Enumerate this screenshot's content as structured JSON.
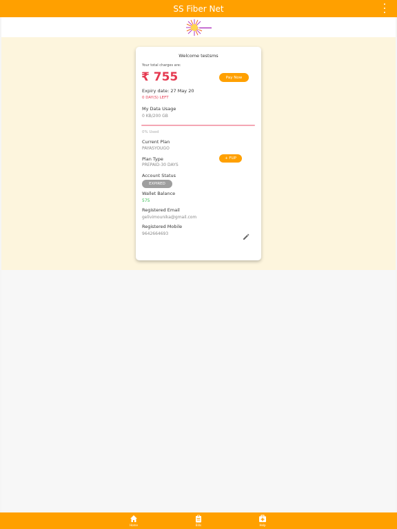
{
  "app": {
    "title": "SS Fiber Net",
    "menu_icon": "more-vert-icon",
    "logo_icon": "ss-fiber-net-logo"
  },
  "card": {
    "welcome": "Welcome testsms",
    "total_label": "Your total charges are:",
    "amount": "₹ 755",
    "pay_now": "Pay Now",
    "expiry": "Expiry date: 27 May 20",
    "days_left": "0 DAY(S) LEFT",
    "data_usage_label": "My Data Usage",
    "data_usage_value": "0 KB/200 GB",
    "usage_fraction": 0,
    "used_text": "0% Used",
    "plan_label": "Current Plan",
    "plan_value": "PAYASYOUGO",
    "fup_button": "+ FUP",
    "plan_type_label": "Plan Type",
    "plan_type_value": "PREPAID-30 DAYS",
    "status_label": "Account Status",
    "status_value": "EXPIRED",
    "wallet_label": "Wallet Balance",
    "wallet_value": "575",
    "email_label": "Registered Email",
    "email_value": "gelivimounika@gmail.com",
    "mobile_label": "Registered Mobile",
    "mobile_value": "9642664693",
    "edit_icon": "edit-icon"
  },
  "bottom_nav": [
    {
      "label": "Home",
      "icon": "home-icon"
    },
    {
      "label": "Bills",
      "icon": "bills-icon"
    },
    {
      "label": "Help",
      "icon": "help-icon"
    }
  ],
  "colors": {
    "accent": "#ffa000",
    "amount": "#e53950",
    "hero_bg": "#fdf5dd",
    "wallet": "#2dbb4a"
  }
}
